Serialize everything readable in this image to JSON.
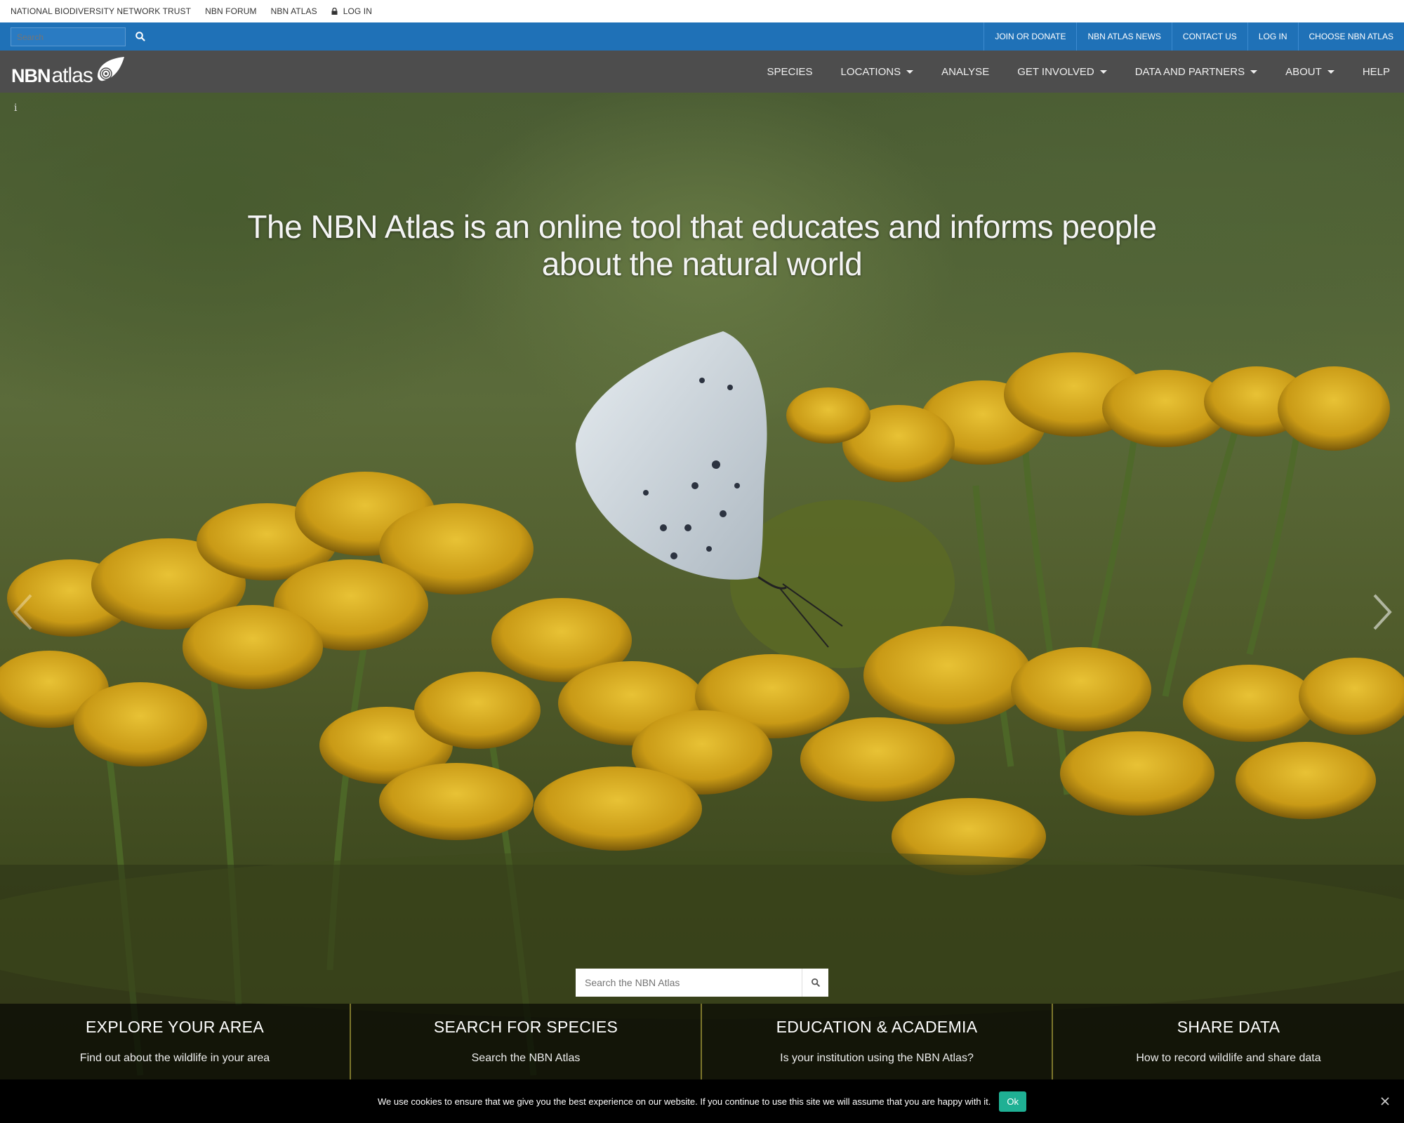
{
  "topbar": {
    "links": [
      "NATIONAL BIODIVERSITY NETWORK TRUST",
      "NBN FORUM",
      "NBN ATLAS"
    ],
    "login": "LOG IN"
  },
  "bluebar": {
    "search_placeholder": "Search",
    "links": [
      "JOIN OR DONATE",
      "NBN ATLAS NEWS",
      "CONTACT US",
      "LOG IN",
      "CHOOSE NBN ATLAS"
    ]
  },
  "logo": {
    "nbn": "NBN",
    "atlas": "atlas"
  },
  "nav": {
    "items": [
      {
        "label": "SPECIES",
        "dropdown": false
      },
      {
        "label": "LOCATIONS",
        "dropdown": true
      },
      {
        "label": "ANALYSE",
        "dropdown": false
      },
      {
        "label": "GET INVOLVED",
        "dropdown": true
      },
      {
        "label": "DATA AND PARTNERS",
        "dropdown": true
      },
      {
        "label": "ABOUT",
        "dropdown": true
      },
      {
        "label": "HELP",
        "dropdown": false
      }
    ]
  },
  "hero": {
    "info": "i",
    "headline": "The NBN Atlas is an online tool that educates and informs people about the natural world",
    "search_placeholder": "Search the NBN Atlas"
  },
  "tiles": [
    {
      "title": "EXPLORE YOUR AREA",
      "subtitle": "Find out about the wildlife in your area"
    },
    {
      "title": "SEARCH FOR SPECIES",
      "subtitle": "Search the NBN Atlas"
    },
    {
      "title": "EDUCATION & ACADEMIA",
      "subtitle": "Is your institution using the NBN Atlas?"
    },
    {
      "title": "SHARE DATA",
      "subtitle": "How to record wildlife and share data"
    }
  ],
  "cookie": {
    "message": "We use cookies to ensure that we give you the best experience on our website. If you continue to use this site we will assume that you are happy with it.",
    "ok": "Ok"
  },
  "colors": {
    "blue_bar": "#1f71b7",
    "nav_bg": "#4d4d4d",
    "cookie_ok": "#1fb094"
  }
}
